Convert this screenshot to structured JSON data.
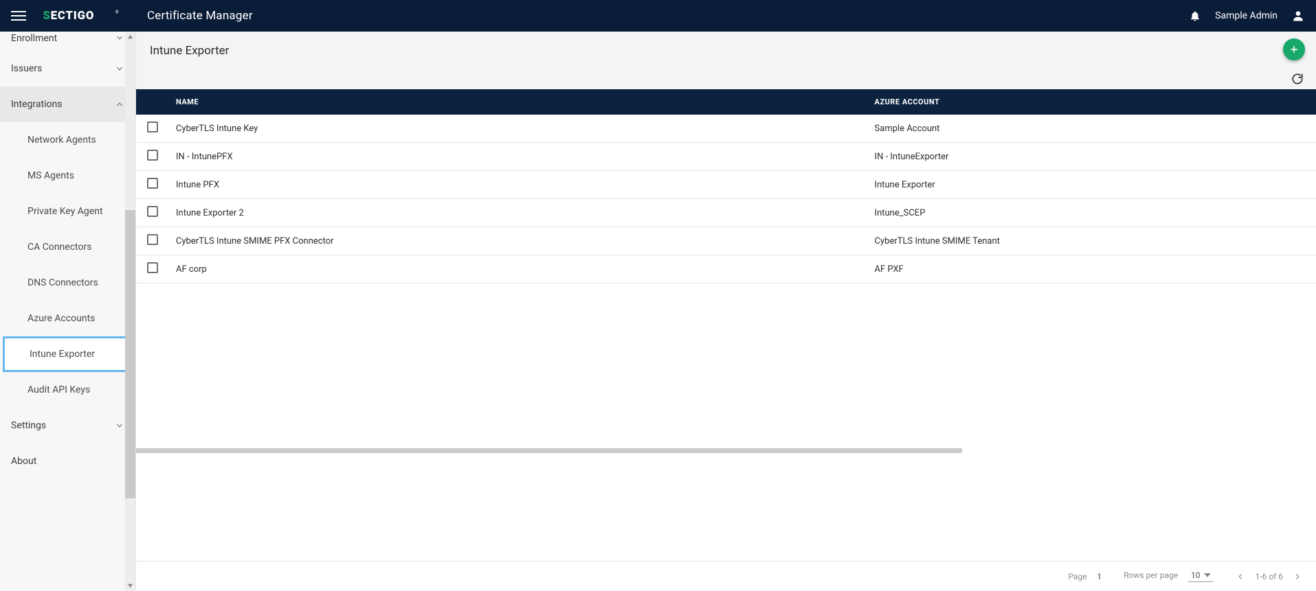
{
  "header": {
    "app_title": "Certificate Manager",
    "username": "Sample Admin"
  },
  "sidebar": {
    "top_cut": "Enrollment",
    "issuers": "Issuers",
    "integrations": "Integrations",
    "children": [
      "Network Agents",
      "MS Agents",
      "Private Key Agent",
      "CA Connectors",
      "DNS Connectors",
      "Azure Accounts",
      "Intune Exporter",
      "Audit API Keys"
    ],
    "settings": "Settings",
    "about": "About"
  },
  "page": {
    "title": "Intune Exporter",
    "columns": {
      "name": "Name",
      "azure": "Azure Account"
    },
    "rows": [
      {
        "name": "CyberTLS Intune Key",
        "account": "Sample Account"
      },
      {
        "name": "IN - IntunePFX",
        "account": "IN - IntuneExporter"
      },
      {
        "name": "Intune PFX",
        "account": "Intune Exporter"
      },
      {
        "name": "Intune Exporter 2",
        "account": "Intune_SCEP"
      },
      {
        "name": "CyberTLS Intune SMIME PFX Connector",
        "account": "CyberTLS Intune SMIME Tenant"
      },
      {
        "name": "AF corp",
        "account": "AF PXF"
      }
    ]
  },
  "pager": {
    "page_label": "Page",
    "page_value": "1",
    "rpp_label": "Rows per page",
    "rpp_value": "10",
    "range": "1-6 of 6"
  }
}
